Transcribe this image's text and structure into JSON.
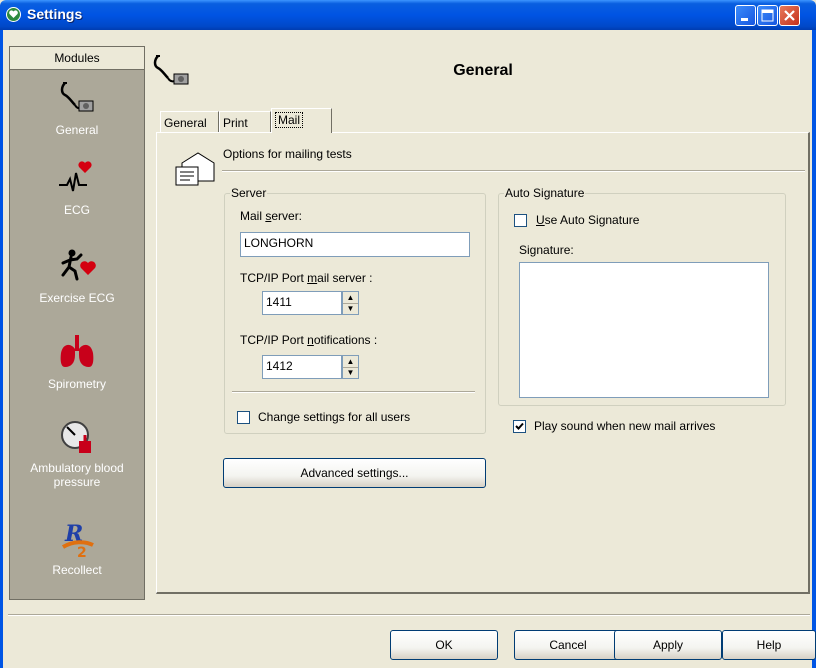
{
  "window": {
    "title": "Settings"
  },
  "modules": {
    "header": "Modules",
    "items": [
      {
        "label": "General",
        "icon": "stethoscope-icon"
      },
      {
        "label": "ECG",
        "icon": "ecg-heart-icon"
      },
      {
        "label": "Exercise ECG",
        "icon": "running-heart-icon"
      },
      {
        "label": "Spirometry",
        "icon": "lungs-icon"
      },
      {
        "label": "Ambulatory blood pressure",
        "icon": "blood-pressure-icon"
      },
      {
        "label": "Recollect",
        "icon": "recollect-icon"
      }
    ]
  },
  "header": {
    "title": "General",
    "icon": "stethoscope-icon"
  },
  "tabs": [
    {
      "label": "General",
      "selected": false
    },
    {
      "label": "Print",
      "selected": false
    },
    {
      "label": "Mail",
      "selected": true
    }
  ],
  "mail": {
    "options_title": "Options for mailing tests",
    "server": {
      "legend": "Server",
      "mail_server_prefix": "Mail ",
      "mail_server_underlined": "s",
      "mail_server_suffix": "erver:",
      "mail_server_value": "LONGHORN",
      "port_mail_prefix": "TCP/IP Port ",
      "port_mail_underlined": "m",
      "port_mail_suffix": "ail server :",
      "port_mail_value": "1411",
      "port_notif_prefix": "TCP/IP Port ",
      "port_notif_underlined": "n",
      "port_notif_suffix": "otifications :",
      "port_notif_value": "1412",
      "change_all_users_label": "Change settings for all users",
      "change_all_users_checked": false
    },
    "auto_signature": {
      "legend": "Auto Signature",
      "use_auto_underlined": "U",
      "use_auto_suffix": "se Auto Signature",
      "use_auto_checked": false,
      "signature_label": "Signature:",
      "signature_value": ""
    },
    "play_sound_label": "Play sound when new mail arrives",
    "play_sound_checked": true,
    "advanced_button": "Advanced settings..."
  },
  "footer": {
    "ok": "OK",
    "cancel": "Cancel",
    "apply": "Apply",
    "help": "Help"
  }
}
